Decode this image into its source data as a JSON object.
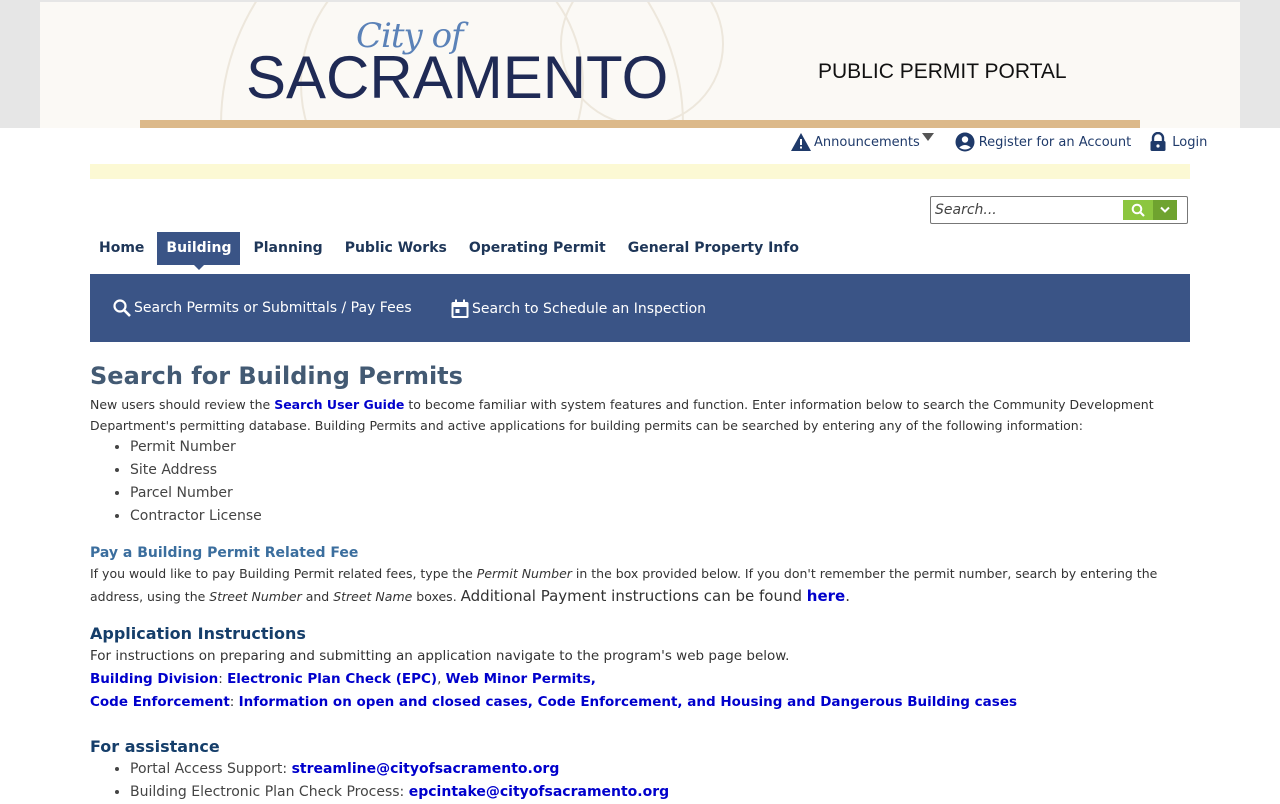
{
  "header": {
    "logo_line1": "City of",
    "logo_line2": "SACRAMENTO",
    "portal_title": "PUBLIC PERMIT PORTAL"
  },
  "toplinks": {
    "announcements": "Announcements",
    "register": "Register for an Account",
    "login": "Login"
  },
  "search": {
    "placeholder": "Search..."
  },
  "tabs": [
    {
      "label": "Home"
    },
    {
      "label": "Building"
    },
    {
      "label": "Planning"
    },
    {
      "label": "Public Works"
    },
    {
      "label": "Operating Permit"
    },
    {
      "label": "General Property Info"
    }
  ],
  "subnav": {
    "search_permits": "Search Permits or Submittals / Pay Fees",
    "schedule_inspection": "Search to Schedule an Inspection"
  },
  "main": {
    "title": "Search for Building Permits",
    "intro_pre": "New users should review the ",
    "intro_link": "Search User Guide",
    "intro_post": " to become familiar with system features and function. Enter information below to search the Community Development Department's permitting database.  Building Permits and active applications for building permits can be searched by entering any of the following information:",
    "criteria": [
      "Permit Number",
      "Site Address",
      "Parcel Number",
      "Contractor License"
    ],
    "pay_heading": "Pay a Building Permit Related Fee",
    "pay_text_1": "If you would like to pay Building Permit related fees, type the ",
    "pay_em_1": "Permit Number",
    "pay_text_2": " in the box provided below.  If you don't remember the permit number, search by entering the address, using the ",
    "pay_em_2": "Street Number",
    "pay_text_3": " and ",
    "pay_em_3": "Street Name",
    "pay_text_4": " boxes. ",
    "pay_text_5": "Additional Payment instructions can be found ",
    "pay_link": "here",
    "pay_text_6": ".",
    "app_heading": "Application Instructions",
    "app_text": "For instructions on preparing and submitting an application navigate to the program's web page below.",
    "bd_label": "Building Division",
    "bd_link1": "Electronic Plan Check (EPC)",
    "bd_link2": "Web Minor Permits",
    "ce_label": "Code Enforcement",
    "ce_link": "Information on open and closed cases, Code Enforcement, and Housing and Dangerous Building cases",
    "assist_heading": "For assistance",
    "assist_items": [
      {
        "label": "Portal Access Support: ",
        "email": "streamline@cityofsacramento.org"
      },
      {
        "label": "Building Electronic Plan Check Process: ",
        "email": "epcintake@cityofsacramento.org"
      }
    ]
  },
  "colors": {
    "nav_blue": "#3a5486",
    "search_green": "#8cc63f",
    "tan_rule": "#dcb98a"
  }
}
